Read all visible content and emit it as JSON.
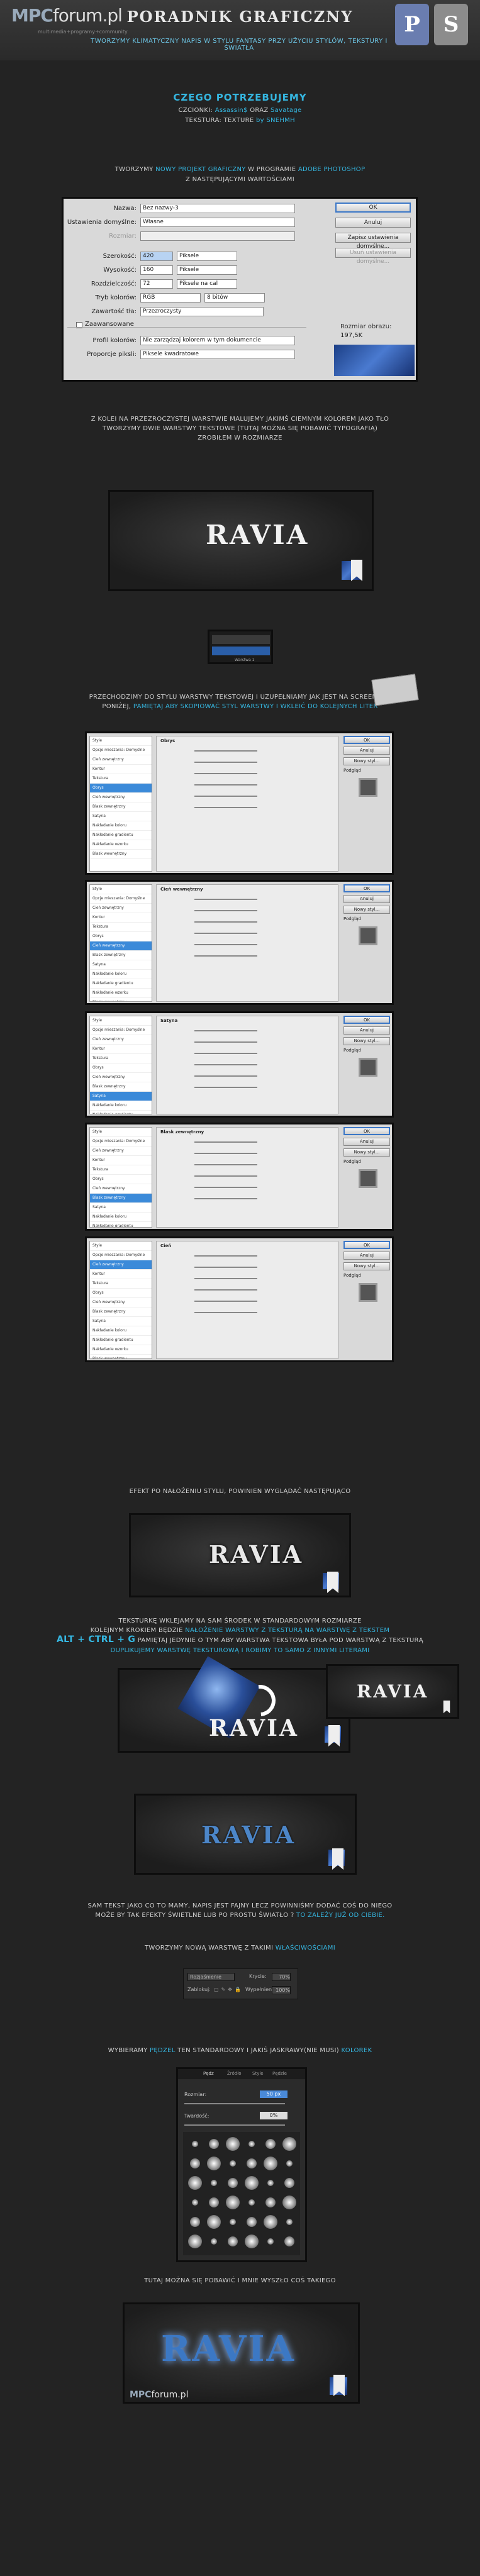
{
  "header": {
    "logo_main": "MPC",
    "logo_rest": "forum.pl",
    "logo_sub": "multimedia+programy+community",
    "title": "PORADNIK GRAFICZNY",
    "subtitle": "TWORZYMY KLIMATYCZNY NAPIS W STYLU FANTASY PRZY UŻYCIU STYLÓW, TEKSTURY I ŚWIATŁA",
    "tags": [
      "P",
      "S"
    ],
    "brand_color": "#35b6e0"
  },
  "needs": {
    "title": "CZEGO POTRZEBUJEMY",
    "fonts_label": "CZCIONKI:",
    "font1": "Assassin$",
    "and": "ORAZ",
    "font2": "Savatage",
    "textures_label": "TEKSTURA: TEXTURE",
    "textures_value": "by SNEHMH"
  },
  "intro": {
    "line1_a": "TWORZYMY",
    "line1_b": "NOWY PROJEKT GRAFICZNY",
    "line1_c": "W PROGRAMIE",
    "line1_d": "ADOBE PHOTOSHOP",
    "line2": "Z NASTĘPUJĄCYMI WARTOŚCIAMI"
  },
  "new_dialog": {
    "name_label": "Nazwa:",
    "name_value": "Bez nazwy-3",
    "preset_label": "Ustawienia domyślne:",
    "preset_value": "Własne",
    "size_label": "Rozmiar:",
    "width_label": "Szerokość:",
    "width_value": "420",
    "width_unit": "Piksele",
    "height_label": "Wysokość:",
    "height_value": "160",
    "height_unit": "Piksele",
    "res_label": "Rozdzielczość:",
    "res_value": "72",
    "res_unit": "Piksele na cal",
    "mode_label": "Tryb kolorów:",
    "mode_value": "RGB",
    "depth_value": "8 bitów",
    "bg_label": "Zawartość tła:",
    "bg_value": "Przezroczysty",
    "advanced_label": "Zaawansowane",
    "profile_label": "Profil kolorów:",
    "profile_value": "Nie zarządzaj kolorem w tym dokumencie",
    "aspect_label": "Proporcje piksli:",
    "aspect_value": "Piksele kwadratowe",
    "btn_ok": "OK",
    "btn_cancel": "Anuluj",
    "btn_save": "Zapisz ustawienia domyślne...",
    "btn_delete": "Usuń ustawienia domyślne...",
    "size_info_label": "Rozmiar obrazu:",
    "size_info_value": "197,5K"
  },
  "step2": {
    "l1": "Z KOLEI NA PRZEZROCZYSTEJ WARSTWIE MALUJEMY JAKIMŚ CIEMNYM KOLOREM JAKO TŁO",
    "l2": "TWORZYMY DWIE WARSTWY TEKSTOWE (TUTAJ MOŻNA SIĘ POBAWIĆ TYPOGRAFIĄ)",
    "l3": "ZROBIŁEM W ROZMIARZE"
  },
  "canvas_text": "RAVIA",
  "layers_thumb": {
    "label": "Warstwa 1"
  },
  "step3": {
    "l1": "PRZECHODZIMY DO STYLU WARSTWY TEKSTOWEJ I UZUPEŁNIAMY JAK JEST NA SCREENACH",
    "l2_a": "PONIŻEJ,",
    "l2_b": "PAMIĘTAJ ABY SKOPIOWAĆ STYL WARSTWY I WKLEIĆ DO KOLEJNYCH LITER"
  },
  "style_list": [
    "Style",
    "Opcje mieszania: Domyślne",
    "Cień zewnętrzny",
    "Kontur",
    "Tekstura",
    "Obrys",
    "Cień wewnętrzny",
    "Blask zewnętrzny",
    "Satyna",
    "Nakładanie koloru",
    "Nakładanie gradientu",
    "Nakładanie wzorku",
    "Blask wewnętrzny"
  ],
  "style_dialogs": [
    {
      "panel_title": "Obrys",
      "sel": 5
    },
    {
      "panel_title": "Cień wewnętrzny",
      "sel": 6
    },
    {
      "panel_title": "Satyna",
      "sel": 8
    },
    {
      "panel_title": "Blask zewnętrzny",
      "sel": 7
    },
    {
      "panel_title": "Cień",
      "sel": 2
    }
  ],
  "style_buttons": {
    "ok": "OK",
    "cancel": "Anuluj",
    "new": "Nowy styl...",
    "preview": "Podgląd"
  },
  "step4": {
    "l1": "EFEKT PO NAŁOŻENIU STYLU, POWINIEN WYGLĄDAĆ NASTĘPUJĄCO"
  },
  "step5": {
    "l1": "TEKSTURKĘ WKLEJAMY NA SAM ŚRODEK W STANDARDOWYM ROZMIARZE",
    "l2_a": "KOLEJNYM KROKIEM BĘDZIE",
    "l2_b": "NAŁOŻENIE WARSTWY Z TEKSTURĄ NA WARSTWĘ Z TEKSTEM",
    "l3_a": "ALT + CTRL + G",
    "l3_b": "PAMIĘTAJ JEDYNIE O TYM ABY WARSTWA TEKSTOWA BYŁA POD WARSTWĄ Z TEKSTURĄ",
    "l4_a": "DUPLIKUJEMY WARSTWĘ TEKSTUROWĄ I ROBIMY TO SAMO Z INNYMI LITERAMI"
  },
  "step6": {
    "l1": "SAM TEKST JAKO CO TO MAMY, NAPIS JEST FAJNY LECZ POWINNIŚMY DODAĆ COŚ DO NIEGO",
    "l2_a": "MOŻE BY TAK EFEKTY ŚWIETLNE LUB PO PROSTU ŚWIATŁO ?",
    "l2_b": "TO ZALEŻY JUŻ OD CIEBIE."
  },
  "step7": {
    "l1_a": "TWORZYMY NOWĄ WARSTWĘ Z TAKIMI",
    "l1_b": "WŁAŚCIWOŚCIAMI"
  },
  "layer_props": {
    "mode": "Rozjaśnienie",
    "opacity_label": "Krycie:",
    "opacity_value": "70%",
    "lock_label": "Zablokuj:",
    "fill_label": "Wypełnienie:",
    "fill_value": "100%"
  },
  "step8": {
    "l1_a": "WYBIERAMY",
    "l1_b": "PĘDZEL",
    "l1_c": "TEN STANDARDOWY I JAKIŚ JASKRAWY(NIE MUSI)",
    "l1_d": "KOLOREK"
  },
  "brush_panel": {
    "size_label": "Rozmiar:",
    "size_value": "50 px",
    "hardness_label": "Twardość:",
    "hardness_value": "0%",
    "tabs": [
      "Pędz",
      "Źródło",
      "Style",
      "Pędzle"
    ]
  },
  "step9": {
    "l1": "TUTAJ MOŻNA SIĘ POBAWIĆ I MNIE WYSZŁO COŚ TAKIEGO"
  },
  "footer": {
    "logo_main": "MPC",
    "logo_rest": "forum.pl"
  }
}
